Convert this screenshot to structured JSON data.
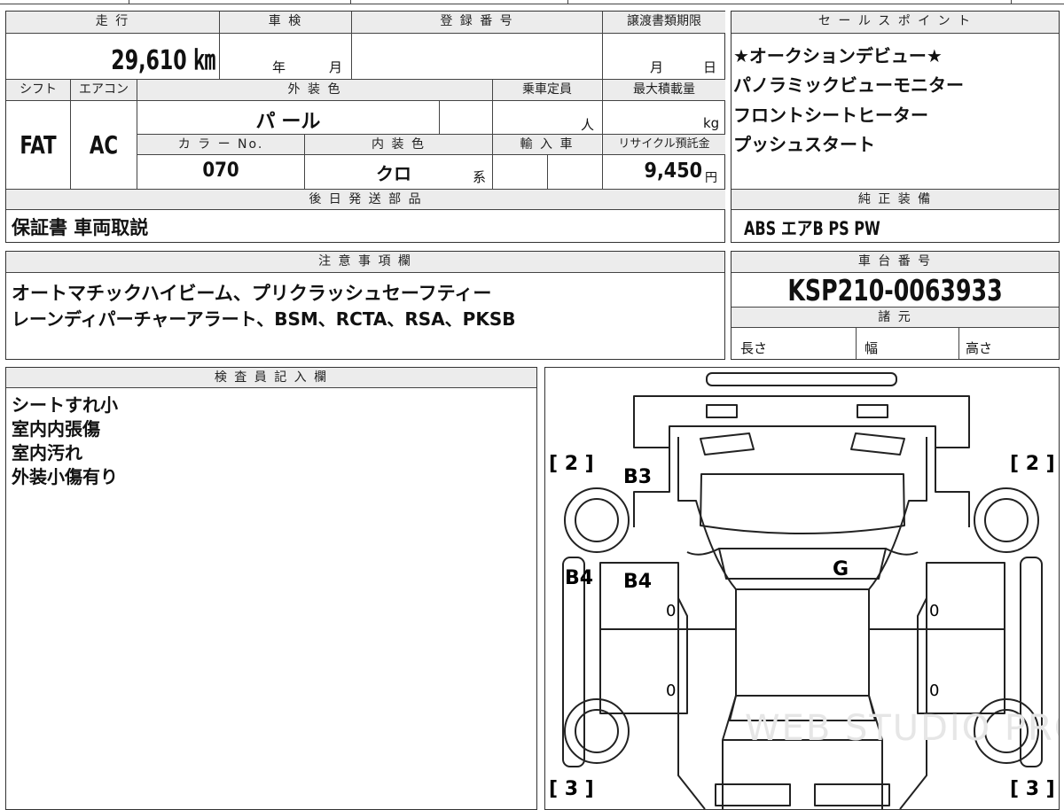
{
  "vehicle_info": {
    "mileage_label": "走 行",
    "mileage_value": "29,610 ㎞",
    "inspection_label": "車 検",
    "inspection_year_unit": "年",
    "inspection_month_unit": "月",
    "registration_label": "登 録 番 号",
    "registration_value": "",
    "transfer_deadline_label": "譲渡書類期限",
    "transfer_month_unit": "月",
    "transfer_day_unit": "日",
    "shift_label": "シフト",
    "shift_value": "FAT",
    "ac_label": "エアコン",
    "ac_value": "AC",
    "exterior_color_label": "外 装 色",
    "exterior_color_value": "パ ール",
    "seating_capacity_label": "乗車定員",
    "seating_capacity_unit": "人",
    "max_load_label": "最大積載量",
    "max_load_unit": "kg",
    "color_no_label": "カ ラ ー No.",
    "color_no_value": "070",
    "interior_color_label": "内 装 色",
    "interior_color_value": "クロ",
    "interior_color_suffix": "系",
    "import_label": "輸 入 車",
    "recycle_fee_label": "リサイクル預託金",
    "recycle_fee_value": "9,450",
    "recycle_fee_unit": "円"
  },
  "sales_points": {
    "title": "セ ー ル ス ポ イ ン ト",
    "items": [
      "★オークションデビュー★",
      "パノラミックビューモニター",
      "フロントシートヒーター",
      "プッシュスタート"
    ]
  },
  "later_shipping": {
    "title": "後 日 発 送 部 品",
    "value": "保証書 車両取説"
  },
  "genuine_equipment": {
    "title": "純 正 装 備",
    "value": "ABS エアB PS PW"
  },
  "notes": {
    "title": "注 意 事 項 欄",
    "lines": [
      "オートマチックハイビーム、プリクラッシュセーフティー",
      "レーンディパーチャーアラート、BSM、RCTA、RSA、PKSB"
    ]
  },
  "chassis": {
    "title": "車 台 番 号",
    "value": "KSP210-0063933",
    "spec_title": "諸 元",
    "length_label": "長さ",
    "width_label": "幅",
    "height_label": "高さ"
  },
  "inspector": {
    "title": "検 査 員 記 入 欄",
    "lines": [
      "シートすれ小",
      "室内内張傷",
      "室内汚れ",
      "外装小傷有り"
    ]
  },
  "diagram": {
    "marks": {
      "front_left_bracket": "[ 2 ]",
      "front_right_bracket": "[ 2 ]",
      "rear_left_bracket": "[ 3 ]",
      "rear_right_bracket": "[ 3 ]",
      "b3": "B3",
      "b4_side": "B4",
      "b4_door": "B4",
      "g": "G",
      "zero": "0"
    },
    "watermark": "WEB STUDIO PRO"
  }
}
